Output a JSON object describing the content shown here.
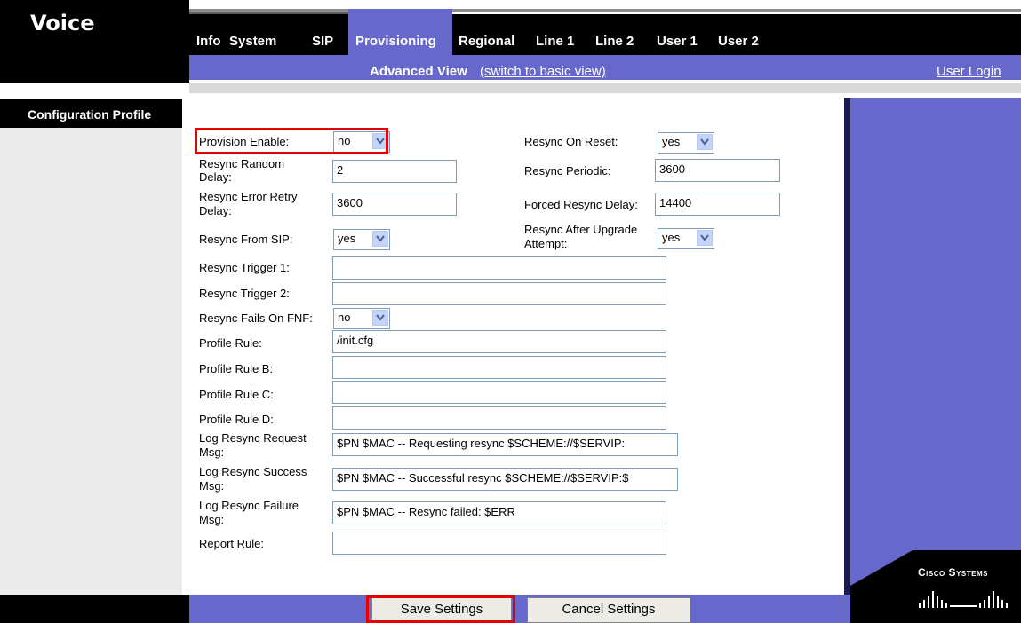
{
  "header": {
    "title": "Voice",
    "tabs": [
      {
        "label": "Info"
      },
      {
        "label": "System"
      },
      {
        "label": "SIP"
      },
      {
        "label": "Provisioning"
      },
      {
        "label": "Regional"
      },
      {
        "label": "Line 1"
      },
      {
        "label": "Line 2"
      },
      {
        "label": "User 1"
      },
      {
        "label": "User 2"
      }
    ],
    "active_tab": "Provisioning",
    "view_label": "Advanced View",
    "view_switch": "(switch to basic view)",
    "user_login": "User Login"
  },
  "section": {
    "title": "Configuration Profile"
  },
  "form": {
    "provision_enable": {
      "label": "Provision Enable:",
      "value": "no"
    },
    "resync_on_reset": {
      "label": "Resync On Reset:",
      "value": "yes"
    },
    "resync_random_delay": {
      "label1": "Resync Random",
      "label2": "Delay:",
      "value": "2"
    },
    "resync_periodic": {
      "label": "Resync Periodic:",
      "value": "3600"
    },
    "resync_error_retry_delay": {
      "label1": "Resync Error Retry",
      "label2": "Delay:",
      "value": "3600"
    },
    "forced_resync_delay": {
      "label": "Forced Resync Delay:",
      "value": "14400"
    },
    "resync_from_sip": {
      "label": "Resync From SIP:",
      "value": "yes"
    },
    "resync_after_upgrade": {
      "label1": "Resync After Upgrade",
      "label2": "Attempt:",
      "value": "yes"
    },
    "resync_trigger_1": {
      "label": "Resync Trigger 1:",
      "value": ""
    },
    "resync_trigger_2": {
      "label": "Resync Trigger 2:",
      "value": ""
    },
    "resync_fails_on_fnf": {
      "label": "Resync Fails On FNF:",
      "value": "no"
    },
    "profile_rule": {
      "label": "Profile Rule:",
      "value": "/init.cfg"
    },
    "profile_rule_b": {
      "label": "Profile Rule B:",
      "value": ""
    },
    "profile_rule_c": {
      "label": "Profile Rule C:",
      "value": ""
    },
    "profile_rule_d": {
      "label": "Profile Rule D:",
      "value": ""
    },
    "log_resync_request_msg": {
      "label1": "Log Resync Request",
      "label2": "Msg:",
      "value": "$PN $MAC -- Requesting resync $SCHEME://$SERVIP:"
    },
    "log_resync_success_msg": {
      "label1": "Log Resync Success",
      "label2": "Msg:",
      "value": "$PN $MAC -- Successful resync $SCHEME://$SERVIP:$"
    },
    "log_resync_failure_msg": {
      "label1": "Log Resync Failure",
      "label2": "Msg:",
      "value": "$PN $MAC -- Resync failed: $ERR"
    },
    "report_rule": {
      "label": "Report Rule:",
      "value": ""
    }
  },
  "buttons": {
    "save": "Save Settings",
    "cancel": "Cancel Settings"
  },
  "logo": {
    "text": "Cisco Systems"
  },
  "colors": {
    "purple": "#6768cc",
    "highlight": "#e60000"
  }
}
